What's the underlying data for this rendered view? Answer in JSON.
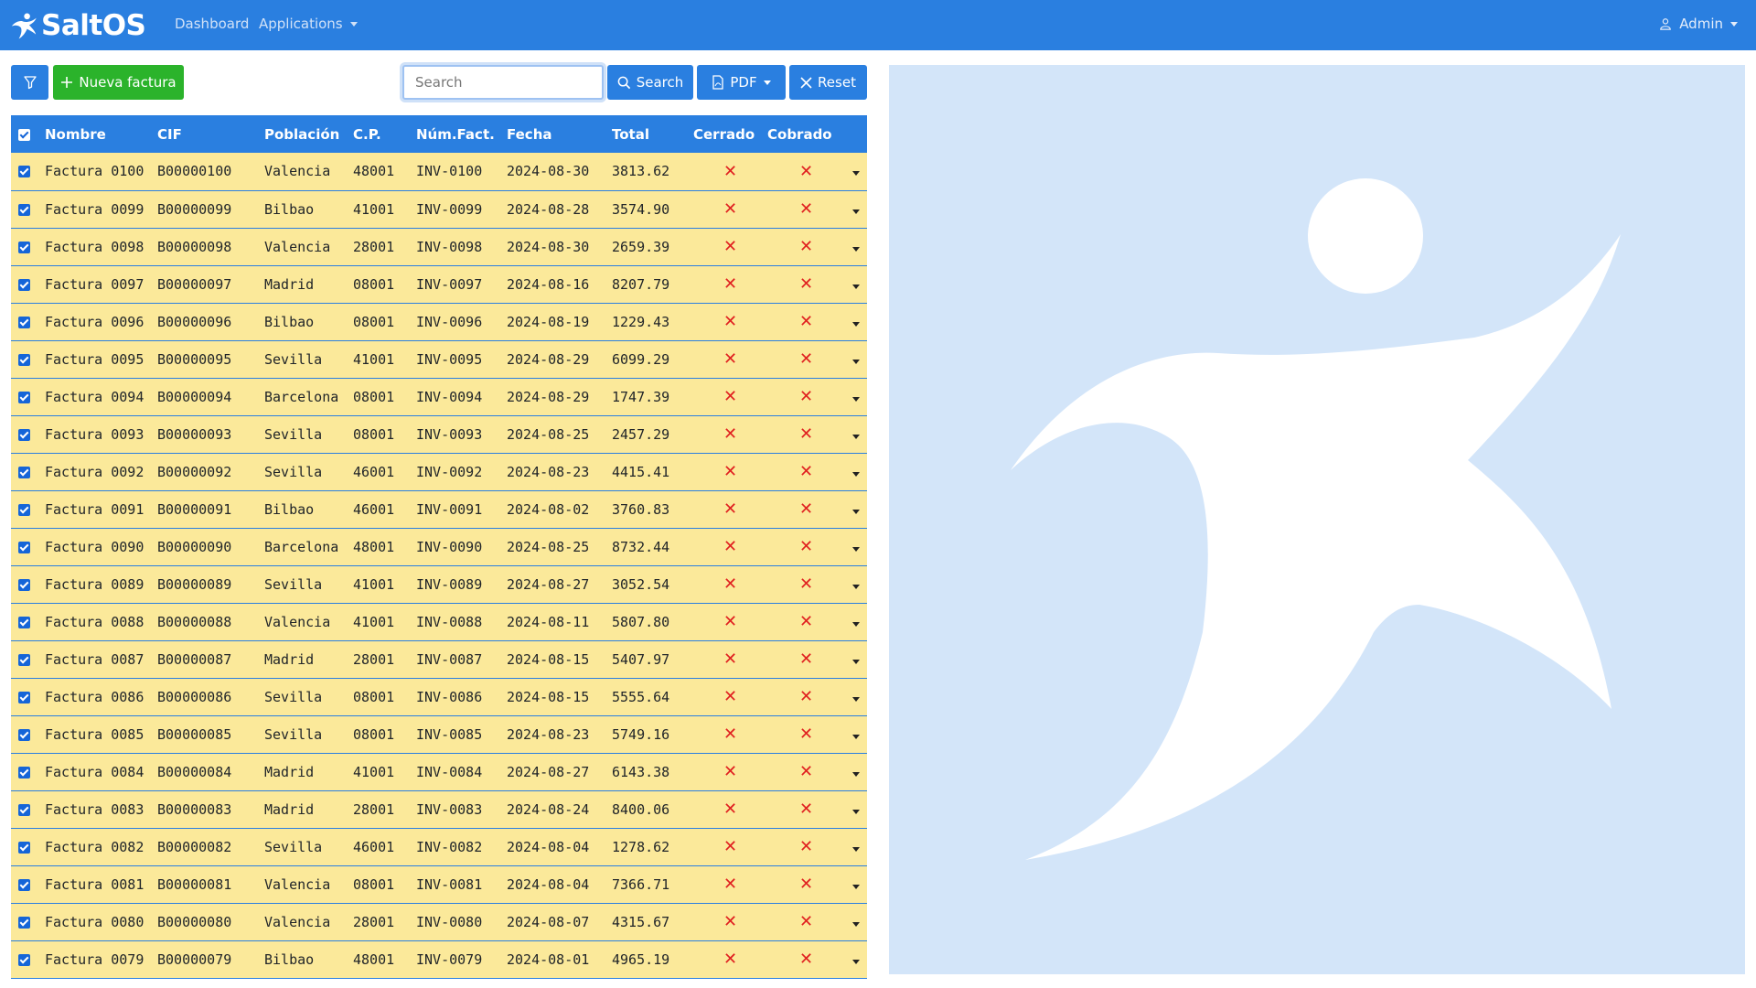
{
  "navbar": {
    "brand": "SaltOS",
    "links": [
      "Dashboard",
      "Applications"
    ],
    "user": "Admin"
  },
  "toolbar": {
    "new_label": "Nueva factura",
    "search_placeholder": "Search",
    "search_label": "Search",
    "pdf_label": "PDF",
    "reset_label": "Reset"
  },
  "table": {
    "columns": [
      "Nombre",
      "CIF",
      "Población",
      "C.P.",
      "Núm.Fact.",
      "Fecha",
      "Total",
      "Cerrado",
      "Cobrado"
    ],
    "rows": [
      [
        "Factura 0100",
        "B00000100",
        "Valencia",
        "48001",
        "INV-0100",
        "2024-08-30",
        "3813.62"
      ],
      [
        "Factura 0099",
        "B00000099",
        "Bilbao",
        "41001",
        "INV-0099",
        "2024-08-28",
        "3574.90"
      ],
      [
        "Factura 0098",
        "B00000098",
        "Valencia",
        "28001",
        "INV-0098",
        "2024-08-30",
        "2659.39"
      ],
      [
        "Factura 0097",
        "B00000097",
        "Madrid",
        "08001",
        "INV-0097",
        "2024-08-16",
        "8207.79"
      ],
      [
        "Factura 0096",
        "B00000096",
        "Bilbao",
        "08001",
        "INV-0096",
        "2024-08-19",
        "1229.43"
      ],
      [
        "Factura 0095",
        "B00000095",
        "Sevilla",
        "41001",
        "INV-0095",
        "2024-08-29",
        "6099.29"
      ],
      [
        "Factura 0094",
        "B00000094",
        "Barcelona",
        "08001",
        "INV-0094",
        "2024-08-29",
        "1747.39"
      ],
      [
        "Factura 0093",
        "B00000093",
        "Sevilla",
        "08001",
        "INV-0093",
        "2024-08-25",
        "2457.29"
      ],
      [
        "Factura 0092",
        "B00000092",
        "Sevilla",
        "46001",
        "INV-0092",
        "2024-08-23",
        "4415.41"
      ],
      [
        "Factura 0091",
        "B00000091",
        "Bilbao",
        "46001",
        "INV-0091",
        "2024-08-02",
        "3760.83"
      ],
      [
        "Factura 0090",
        "B00000090",
        "Barcelona",
        "48001",
        "INV-0090",
        "2024-08-25",
        "8732.44"
      ],
      [
        "Factura 0089",
        "B00000089",
        "Sevilla",
        "41001",
        "INV-0089",
        "2024-08-27",
        "3052.54"
      ],
      [
        "Factura 0088",
        "B00000088",
        "Valencia",
        "41001",
        "INV-0088",
        "2024-08-11",
        "5807.80"
      ],
      [
        "Factura 0087",
        "B00000087",
        "Madrid",
        "28001",
        "INV-0087",
        "2024-08-15",
        "5407.97"
      ],
      [
        "Factura 0086",
        "B00000086",
        "Sevilla",
        "08001",
        "INV-0086",
        "2024-08-15",
        "5555.64"
      ],
      [
        "Factura 0085",
        "B00000085",
        "Sevilla",
        "08001",
        "INV-0085",
        "2024-08-23",
        "5749.16"
      ],
      [
        "Factura 0084",
        "B00000084",
        "Madrid",
        "41001",
        "INV-0084",
        "2024-08-27",
        "6143.38"
      ],
      [
        "Factura 0083",
        "B00000083",
        "Madrid",
        "28001",
        "INV-0083",
        "2024-08-24",
        "8400.06"
      ],
      [
        "Factura 0082",
        "B00000082",
        "Sevilla",
        "46001",
        "INV-0082",
        "2024-08-04",
        "1278.62"
      ],
      [
        "Factura 0081",
        "B00000081",
        "Valencia",
        "08001",
        "INV-0081",
        "2024-08-04",
        "7366.71"
      ],
      [
        "Factura 0080",
        "B00000080",
        "Valencia",
        "28001",
        "INV-0080",
        "2024-08-07",
        "4315.67"
      ],
      [
        "Factura 0079",
        "B00000079",
        "Bilbao",
        "48001",
        "INV-0079",
        "2024-08-01",
        "4965.19"
      ]
    ],
    "cerrado_icon": "x-icon",
    "cobrado_icon": "x-icon"
  },
  "colors": {
    "primary": "#2a7fe0",
    "success": "#2bb32b",
    "row_bg": "#fbe99a",
    "danger": "#e02020",
    "logo_bg": "#d3e5f9"
  }
}
